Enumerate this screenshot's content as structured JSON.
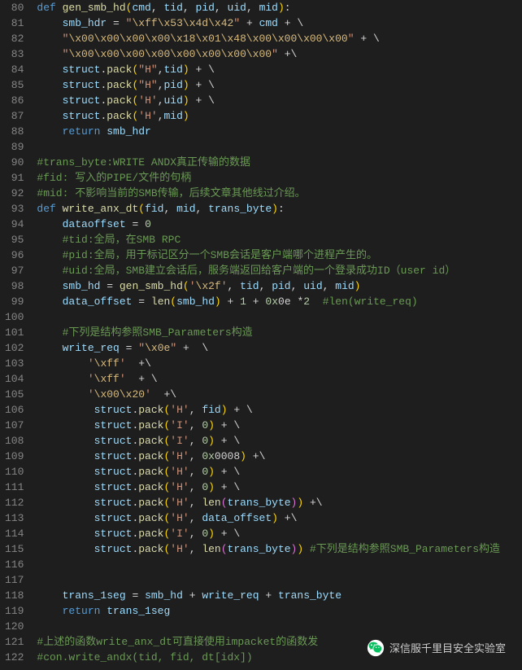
{
  "lines": [
    {
      "n": 80,
      "h": "<span class='kw'>def</span> <span class='fn'>gen_smb_hd</span><span class='brk'>(</span><span class='var'>cmd</span><span class='p'>,</span> <span class='var'>tid</span><span class='p'>,</span> <span class='var'>pid</span><span class='p'>,</span> <span class='var'>uid</span><span class='p'>,</span> <span class='var'>mid</span><span class='brk'>)</span><span class='p'>:</span>"
    },
    {
      "n": 81,
      "h": "    <span class='var'>smb_hdr</span> <span class='op'>=</span> <span class='str'>\"<span class='esc'>\\xff\\x53\\x4d\\x42</span>\"</span> <span class='op'>+</span> <span class='var'>cmd</span> <span class='op'>+</span> <span class='p'>\\</span>"
    },
    {
      "n": 82,
      "h": "    <span class='str'>\"<span class='esc'>\\x00\\x00\\x00\\x00\\x18\\x01\\x48\\x00\\x00\\x00\\x00</span>\"</span> <span class='op'>+</span> <span class='p'>\\</span>"
    },
    {
      "n": 83,
      "h": "    <span class='str'>\"<span class='esc'>\\x00\\x00\\x00\\x00\\x00\\x00\\x00\\x00</span>\"</span> <span class='op'>+</span><span class='p'>\\</span>"
    },
    {
      "n": 84,
      "h": "    <span class='var'>struct</span><span class='p'>.</span><span class='fn'>pack</span><span class='brk'>(</span><span class='str'>\"H\"</span><span class='p'>,</span><span class='var'>tid</span><span class='brk'>)</span> <span class='op'>+</span> <span class='p'>\\</span>"
    },
    {
      "n": 85,
      "h": "    <span class='var'>struct</span><span class='p'>.</span><span class='fn'>pack</span><span class='brk'>(</span><span class='str'>\"H\"</span><span class='p'>,</span><span class='var'>pid</span><span class='brk'>)</span> <span class='op'>+</span> <span class='p'>\\</span>"
    },
    {
      "n": 86,
      "h": "    <span class='var'>struct</span><span class='p'>.</span><span class='fn'>pack</span><span class='brk'>(</span><span class='str'>'H'</span><span class='p'>,</span><span class='var'>uid</span><span class='brk'>)</span> <span class='op'>+</span> <span class='p'>\\</span>"
    },
    {
      "n": 87,
      "h": "    <span class='var'>struct</span><span class='p'>.</span><span class='fn'>pack</span><span class='brk'>(</span><span class='str'>'H'</span><span class='p'>,</span><span class='var'>mid</span><span class='brk'>)</span>"
    },
    {
      "n": 88,
      "h": "    <span class='kw'>return</span> <span class='var'>smb_hdr</span>"
    },
    {
      "n": 89,
      "h": ""
    },
    {
      "n": 90,
      "h": "<span class='com'>#trans_byte:WRITE ANDX真正传输的数据</span>"
    },
    {
      "n": 91,
      "h": "<span class='com'>#fid: 写入的PIPE/文件的句柄</span>"
    },
    {
      "n": 92,
      "h": "<span class='com'>#mid: 不影响当前的SMB传输，后续文章其他线过介绍。</span>"
    },
    {
      "n": 93,
      "h": "<span class='kw'>def</span> <span class='fn'>write_anx_dt</span><span class='brk'>(</span><span class='var'>fid</span><span class='p'>,</span> <span class='var'>mid</span><span class='p'>,</span> <span class='var'>trans_byte</span><span class='brk'>)</span><span class='p'>:</span>"
    },
    {
      "n": 94,
      "h": "    <span class='var'>dataoffset</span> <span class='op'>=</span> <span class='num'>0</span>"
    },
    {
      "n": 95,
      "h": "    <span class='com'>#tid:全局，在SMB RPC</span>"
    },
    {
      "n": 96,
      "h": "    <span class='com'>#pid:全局，用于标记区分一个SMB会话是客户端哪个进程产生的。</span>"
    },
    {
      "n": 97,
      "h": "    <span class='com'>#uid:全局，SMB建立会话后，服务端返回给客户端的一个登录成功ID（user id）</span>"
    },
    {
      "n": 98,
      "h": "    <span class='var'>smb_hd</span> <span class='op'>=</span> <span class='fn'>gen_smb_hd</span><span class='brk'>(</span><span class='str'>'<span class='esc'>\\x2f</span>'</span><span class='p'>,</span> <span class='var'>tid</span><span class='p'>,</span> <span class='var'>pid</span><span class='p'>,</span> <span class='var'>uid</span><span class='p'>,</span> <span class='var'>mid</span><span class='brk'>)</span>"
    },
    {
      "n": 99,
      "h": "    <span class='var'>data_offset</span> <span class='op'>=</span> <span class='fn'>len</span><span class='brk'>(</span><span class='var'>smb_hd</span><span class='brk'>)</span> <span class='op'>+</span> <span class='num'>1</span> <span class='op'>+</span> <span class='num'>0x</span><span class='p'>0e</span> <span class='op'>*</span><span class='num'>2</span>  <span class='com'>#len(write_req)</span>"
    },
    {
      "n": 100,
      "h": ""
    },
    {
      "n": 101,
      "h": "    <span class='com'>#下列是结构参照SMB_Parameters构造</span>"
    },
    {
      "n": 102,
      "h": "    <span class='var'>write_req</span> <span class='op'>=</span> <span class='str'>\"<span class='esc'>\\x0e</span>\"</span> <span class='op'>+</span>  <span class='p'>\\</span>"
    },
    {
      "n": 103,
      "h": "        <span class='str'>'<span class='esc'>\\xff</span>'</span>  <span class='op'>+</span><span class='p'>\\</span>"
    },
    {
      "n": 104,
      "h": "        <span class='str'>'<span class='esc'>\\xff</span>'</span>  <span class='op'>+</span> <span class='p'>\\</span>"
    },
    {
      "n": 105,
      "h": "        <span class='str'>'<span class='esc'>\\x00\\x20</span>'</span>  <span class='op'>+</span><span class='p'>\\</span>"
    },
    {
      "n": 106,
      "h": "         <span class='var'>struct</span><span class='p'>.</span><span class='fn'>pack</span><span class='brk'>(</span><span class='str'>'H'</span><span class='p'>,</span> <span class='var'>fid</span><span class='brk'>)</span> <span class='op'>+</span> <span class='p'>\\</span>"
    },
    {
      "n": 107,
      "h": "         <span class='var'>struct</span><span class='p'>.</span><span class='fn'>pack</span><span class='brk'>(</span><span class='str'>'I'</span><span class='p'>,</span> <span class='num'>0</span><span class='brk'>)</span> <span class='op'>+</span> <span class='p'>\\</span>"
    },
    {
      "n": 108,
      "h": "         <span class='var'>struct</span><span class='p'>.</span><span class='fn'>pack</span><span class='brk'>(</span><span class='str'>'I'</span><span class='p'>,</span> <span class='num'>0</span><span class='brk'>)</span> <span class='op'>+</span> <span class='p'>\\</span>"
    },
    {
      "n": 109,
      "h": "         <span class='var'>struct</span><span class='p'>.</span><span class='fn'>pack</span><span class='brk'>(</span><span class='str'>'H'</span><span class='p'>,</span> <span class='num'>0x</span><span class='p'>0008</span><span class='brk'>)</span> <span class='op'>+</span><span class='p'>\\</span>"
    },
    {
      "n": 110,
      "h": "         <span class='var'>struct</span><span class='p'>.</span><span class='fn'>pack</span><span class='brk'>(</span><span class='str'>'H'</span><span class='p'>,</span> <span class='num'>0</span><span class='brk'>)</span> <span class='op'>+</span> <span class='p'>\\</span>"
    },
    {
      "n": 111,
      "h": "         <span class='var'>struct</span><span class='p'>.</span><span class='fn'>pack</span><span class='brk'>(</span><span class='str'>'H'</span><span class='p'>,</span> <span class='num'>0</span><span class='brk'>)</span> <span class='op'>+</span> <span class='p'>\\</span>"
    },
    {
      "n": 112,
      "h": "         <span class='var'>struct</span><span class='p'>.</span><span class='fn'>pack</span><span class='brk'>(</span><span class='str'>'H'</span><span class='p'>,</span> <span class='fn'>len</span><span class='brk2'>(</span><span class='var'>trans_byte</span><span class='brk2'>)</span><span class='brk'>)</span> <span class='op'>+</span><span class='p'>\\</span>"
    },
    {
      "n": 113,
      "h": "         <span class='var'>struct</span><span class='p'>.</span><span class='fn'>pack</span><span class='brk'>(</span><span class='str'>'H'</span><span class='p'>,</span> <span class='var'>data_offset</span><span class='brk'>)</span> <span class='op'>+</span><span class='p'>\\</span>"
    },
    {
      "n": 114,
      "h": "         <span class='var'>struct</span><span class='p'>.</span><span class='fn'>pack</span><span class='brk'>(</span><span class='str'>'I'</span><span class='p'>,</span> <span class='num'>0</span><span class='brk'>)</span> <span class='op'>+</span> <span class='p'>\\</span>"
    },
    {
      "n": 115,
      "h": "         <span class='var'>struct</span><span class='p'>.</span><span class='fn'>pack</span><span class='brk'>(</span><span class='str'>'H'</span><span class='p'>,</span> <span class='fn'>len</span><span class='brk2'>(</span><span class='var'>trans_byte</span><span class='brk2'>)</span><span class='brk'>)</span> <span class='com'>#下列是结构参照SMB_Parameters构造</span>"
    },
    {
      "n": 116,
      "h": ""
    },
    {
      "n": 117,
      "h": ""
    },
    {
      "n": 118,
      "h": "    <span class='var'>trans_1seg</span> <span class='op'>=</span> <span class='var'>smb_hd</span> <span class='op'>+</span> <span class='var'>write_req</span> <span class='op'>+</span> <span class='var'>trans_byte</span>"
    },
    {
      "n": 119,
      "h": "    <span class='kw'>return</span> <span class='var'>trans_1seg</span>"
    },
    {
      "n": 120,
      "h": ""
    },
    {
      "n": 121,
      "h": "<span class='com'>#上述的函数write_anx_dt可直接使用impacket的函数发</span>"
    },
    {
      "n": 122,
      "h": "<span class='com'>#con.write_andx(tid, fid, dt[idx])</span>"
    }
  ],
  "watermark": {
    "text": "深信服千里目安全实验室"
  }
}
